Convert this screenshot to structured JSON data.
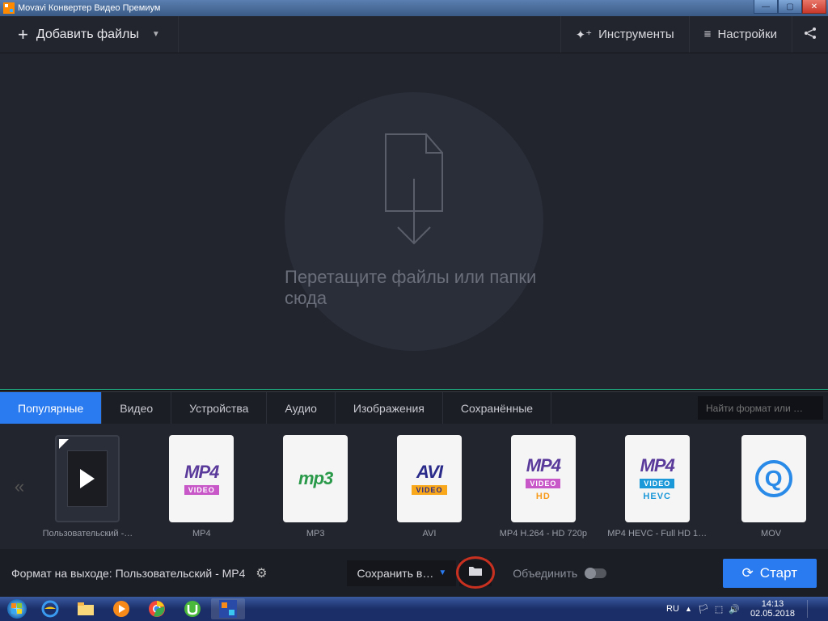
{
  "window": {
    "title": "Movavi Конвертер Видео Премиум"
  },
  "toolbar": {
    "add_label": "Добавить файлы",
    "tools_label": "Инструменты",
    "settings_label": "Настройки"
  },
  "dropzone": {
    "text": "Перетащите файлы или папки сюда"
  },
  "tabs": {
    "popular": "Популярные",
    "video": "Видео",
    "devices": "Устройства",
    "audio": "Аудио",
    "images": "Изображения",
    "saved": "Сохранённые",
    "search_placeholder": "Найти формат или …"
  },
  "presets": {
    "items": [
      {
        "label": "Пользовательский -…"
      },
      {
        "label": "MP4"
      },
      {
        "label": "MP3"
      },
      {
        "label": "AVI"
      },
      {
        "label": "MP4 H.264 - HD 720p"
      },
      {
        "label": "MP4 HEVC - Full HD 1…"
      },
      {
        "label": "MOV"
      }
    ]
  },
  "bottom": {
    "format_label": "Формат на выходе: Пользовательский - MP4",
    "save_label": "Сохранить в…",
    "merge_label": "Объединить",
    "start_label": "Старт"
  },
  "taskbar": {
    "lang": "RU",
    "time": "14:13",
    "date": "02.05.2018"
  }
}
